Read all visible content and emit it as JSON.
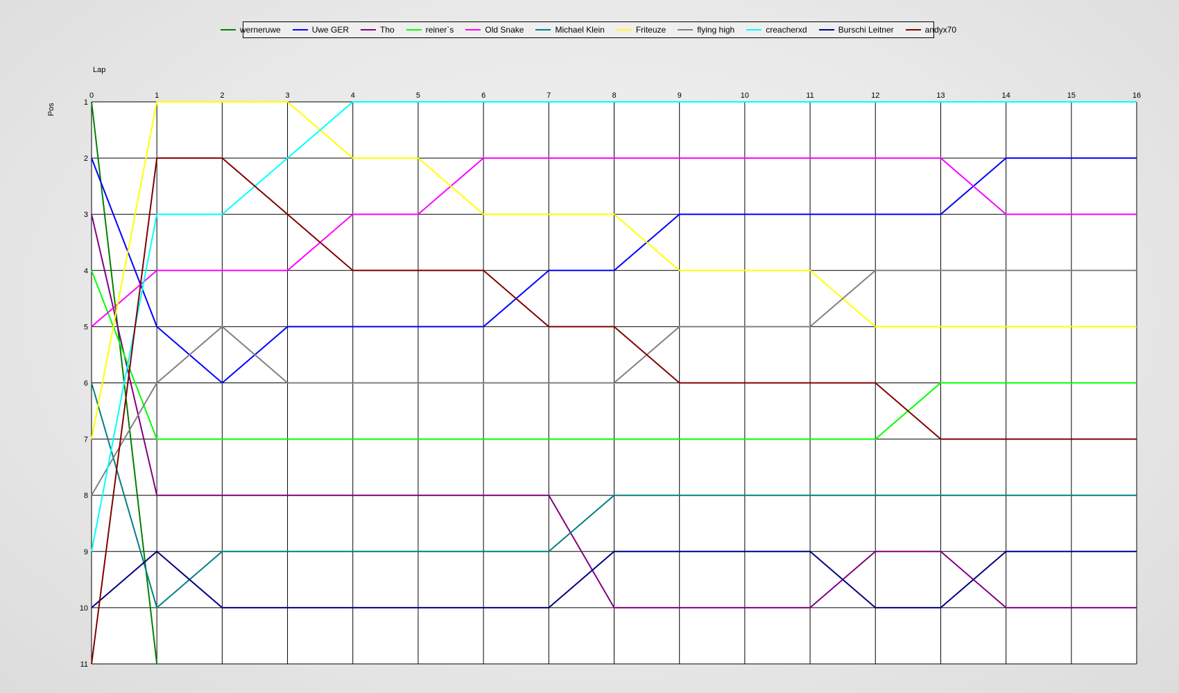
{
  "chart_data": {
    "type": "line",
    "title": "",
    "xlabel": "Lap",
    "ylabel": "Pos",
    "x": [
      0,
      1,
      2,
      3,
      4,
      5,
      6,
      7,
      8,
      9,
      10,
      11,
      12,
      13,
      14,
      15,
      16
    ],
    "xlim": [
      0,
      16
    ],
    "ylim": [
      1,
      11
    ],
    "y_inverted": true,
    "y_ticks": [
      1,
      2,
      3,
      4,
      5,
      6,
      7,
      8,
      9,
      10,
      11
    ],
    "grid": true,
    "legend_position": "top-center",
    "series": [
      {
        "name": "werneruwe",
        "color": "#008000",
        "values": [
          1,
          11
        ]
      },
      {
        "name": "Uwe GER",
        "color": "#0000ff",
        "values": [
          2,
          5,
          6,
          5,
          5,
          5,
          5,
          4,
          4,
          3,
          3,
          3,
          3,
          3,
          2,
          2,
          2
        ]
      },
      {
        "name": "Tho",
        "color": "#800080",
        "values": [
          3,
          8,
          8,
          8,
          8,
          8,
          8,
          8,
          10,
          10,
          10,
          10,
          9,
          9,
          10,
          10,
          10
        ]
      },
      {
        "name": "reiner`s",
        "color": "#00ff00",
        "values": [
          4,
          7,
          7,
          7,
          7,
          7,
          7,
          7,
          7,
          7,
          7,
          7,
          7,
          6,
          6,
          6,
          6
        ]
      },
      {
        "name": "Old Snake",
        "color": "#ff00ff",
        "values": [
          5,
          4,
          4,
          4,
          3,
          3,
          2,
          2,
          2,
          2,
          2,
          2,
          2,
          2,
          3,
          3,
          3
        ]
      },
      {
        "name": "Michael Klein",
        "color": "#008080",
        "values": [
          6,
          10,
          9,
          9,
          9,
          9,
          9,
          9,
          8,
          8,
          8,
          8,
          8,
          8,
          8,
          8,
          8
        ]
      },
      {
        "name": "Friteuze",
        "color": "#ffff00",
        "values": [
          7,
          1,
          1,
          1,
          2,
          2,
          3,
          3,
          3,
          4,
          4,
          4,
          5,
          5,
          5,
          5,
          5
        ]
      },
      {
        "name": "flying high",
        "color": "#808080",
        "values": [
          8,
          6,
          5,
          6,
          6,
          6,
          6,
          6,
          6,
          5,
          5,
          5,
          4,
          4,
          4,
          4,
          4
        ]
      },
      {
        "name": "creacherxd",
        "color": "#00ffff",
        "values": [
          9,
          3,
          3,
          2,
          1,
          1,
          1,
          1,
          1,
          1,
          1,
          1,
          1,
          1,
          1,
          1,
          1
        ]
      },
      {
        "name": "Burschi Leitner",
        "color": "#000080",
        "values": [
          10,
          9,
          10,
          10,
          10,
          10,
          10,
          10,
          9,
          9,
          9,
          9,
          10,
          10,
          9,
          9,
          9
        ]
      },
      {
        "name": "andyx70",
        "color": "#800000",
        "values": [
          11,
          2,
          2,
          3,
          4,
          4,
          4,
          5,
          5,
          6,
          6,
          6,
          6,
          7,
          7,
          7,
          7
        ]
      }
    ]
  }
}
